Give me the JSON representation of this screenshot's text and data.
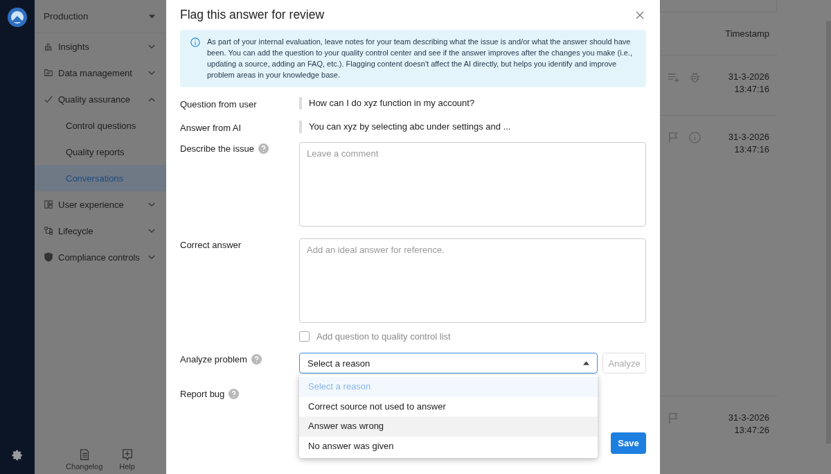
{
  "sidebar": {
    "workspace": "Production",
    "items": [
      {
        "label": "Insights",
        "selected": false,
        "expanded": false
      },
      {
        "label": "Data management",
        "selected": false,
        "expanded": false
      },
      {
        "label": "Quality assurance",
        "selected": false,
        "expanded": true,
        "children": [
          {
            "label": "Control questions",
            "selected": false
          },
          {
            "label": "Quality reports",
            "selected": false
          },
          {
            "label": "Conversations",
            "selected": true
          }
        ]
      },
      {
        "label": "User experience",
        "selected": false,
        "expanded": false
      },
      {
        "label": "Lifecycle",
        "selected": false,
        "expanded": false
      },
      {
        "label": "Compliance controls",
        "selected": false,
        "expanded": false
      }
    ],
    "footer": [
      "Changelog",
      "Help"
    ]
  },
  "table": {
    "columns": [
      "Timestamp"
    ],
    "rows": [
      {
        "actions": [
          {
            "kind": "add-to-list"
          },
          {
            "kind": "bug"
          }
        ],
        "date": "31-3-2026",
        "time": "13:47:16"
      },
      {
        "actions": [
          {
            "kind": "flag"
          },
          {
            "kind": "info"
          }
        ],
        "date": "31-3-2026",
        "time": "13:47:16"
      },
      {
        "actions": [
          {
            "kind": "flag"
          }
        ],
        "date": "31-3-2026",
        "time": "13:47:26"
      }
    ]
  },
  "modal": {
    "title": "Flag this answer for review",
    "info": "As part of your internal evaluation, leave notes for your team describing what the issue is and/or what the answer should have been. You can add the question to your quality control center and see if the answer improves after the changes you make (i.e., updating a source, adding an FAQ, etc.). Flagging content doesn't affect the AI directly, but helps you identify and improve problem areas in your knowledge base.",
    "fields": [
      {
        "kind": "quote",
        "label": "Question from user",
        "value": "How can I do xyz function in my account?"
      },
      {
        "kind": "quote",
        "label": "Answer from AI",
        "value": "You can xyz by selecting abc under settings and ..."
      },
      {
        "kind": "textarea",
        "label": "Describe the issue",
        "help": true,
        "placeholder": "Leave a comment"
      },
      {
        "kind": "textarea",
        "label": "Correct answer",
        "placeholder": "Add an ideal answer for reference."
      },
      {
        "kind": "checkbox",
        "label": "Add question to quality control list",
        "checked": false
      },
      {
        "kind": "select",
        "label": "Analyze problem",
        "help": true,
        "value": "Select a reason",
        "open": true,
        "button": "Analyze",
        "button_disabled": true,
        "options": [
          {
            "label": "Select a reason",
            "selected": true,
            "hovered": false
          },
          {
            "label": "Correct source not used to answer",
            "selected": false,
            "hovered": false
          },
          {
            "label": "Answer was wrong",
            "selected": false,
            "hovered": true
          },
          {
            "label": "No answer was given",
            "selected": false,
            "hovered": false
          }
        ]
      },
      {
        "kind": "plain",
        "label": "Report bug",
        "help": true
      }
    ],
    "save": "Save"
  }
}
